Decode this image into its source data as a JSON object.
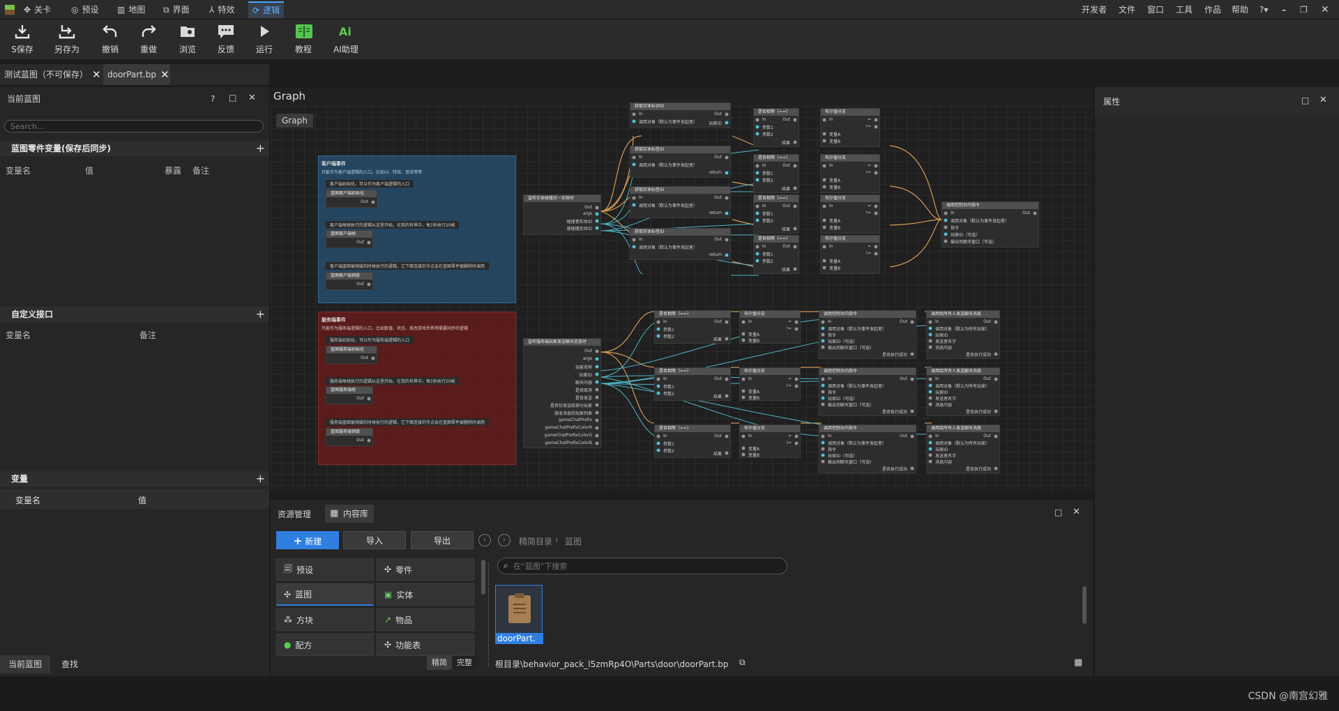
{
  "menubar": {
    "tabs": [
      {
        "label": "关卡",
        "icon": "compass-icon"
      },
      {
        "label": "预设",
        "icon": "target-icon"
      },
      {
        "label": "地图",
        "icon": "map-icon"
      },
      {
        "label": "界面",
        "icon": "ui-icon"
      },
      {
        "label": "特效",
        "icon": "effects-icon"
      },
      {
        "label": "逻辑",
        "icon": "logic-icon",
        "active": true
      }
    ],
    "right_menus": [
      "开发者",
      "文件",
      "窗口",
      "工具",
      "作品",
      "帮助"
    ],
    "help_icon": "?▾"
  },
  "toolbar": {
    "buttons": [
      {
        "label": "S保存",
        "icon": "save-icon"
      },
      {
        "label": "另存为",
        "icon": "save-as-icon"
      },
      {
        "label": "撤销",
        "icon": "undo-icon"
      },
      {
        "label": "重做",
        "icon": "redo-icon"
      },
      {
        "label": "浏览",
        "icon": "browse-icon"
      },
      {
        "label": "反馈",
        "icon": "feedback-icon"
      },
      {
        "label": "运行",
        "icon": "run-icon"
      },
      {
        "label": "教程",
        "icon": "tutorial-icon"
      },
      {
        "label": "AI助理",
        "icon": "ai-icon"
      }
    ]
  },
  "doc_tabs": [
    {
      "label": "测试蓝图（不可保存）"
    },
    {
      "label": "doorPart.bp",
      "active": true
    }
  ],
  "left_panel": {
    "title": "当前蓝图",
    "search_placeholder": "Search...",
    "section1": {
      "title": "蓝图零件变量(保存后同步)",
      "cols": [
        "变量名",
        "值",
        "暴露",
        "备注"
      ]
    },
    "section2": {
      "title": "自定义接口",
      "cols": [
        "变量名",
        "备注"
      ]
    },
    "section3": {
      "title": "变量",
      "cols": [
        "变量名",
        "值"
      ]
    },
    "bottom_tabs": [
      "当前蓝图",
      "查找"
    ]
  },
  "graph": {
    "title": "Graph",
    "breadcrumb": "Graph",
    "client_comment": {
      "title": "客户端事件",
      "subtitle": "只能作为客户端逻辑的入口，比如UI、特效、音效等等",
      "items": [
        {
          "desc": "客户端初始化，可以作为客户端逻辑的入口",
          "node": "蓝图客户端初始化",
          "pin": "Out"
        },
        {
          "desc": "客户端每帧执行的逻辑从这里开始，在我的世界中，每1秒执行20帧",
          "node": "蓝图客户端帧",
          "pin": "Out"
        },
        {
          "desc": "客户端蓝图被销毁的时候执行的逻辑，它下面连接的节点会在蓝图零件被删除时调用",
          "node": "蓝图客户端销毁",
          "pin": "Out"
        }
      ]
    },
    "server_comment": {
      "title": "服务端事件",
      "subtitle": "只能作为服务端逻辑的入口，比如数值、状态、修改游戏世界等需要同步的逻辑",
      "items": [
        {
          "desc": "服务端初始化，可以作为服务端逻辑的入口",
          "node": "蓝图服务端初始化",
          "pin": "Out"
        },
        {
          "desc": "服务端每帧执行的逻辑从这里开始，在我的世界中，每1秒执行20帧",
          "node": "蓝图服务端帧",
          "pin": "Out"
        },
        {
          "desc": "服务端蓝图被销毁的时候执行的逻辑，它下面连接的节点会在蓝图零件被删除时调用",
          "node": "蓝图服务端销毁",
          "pin": "Out"
        }
      ]
    },
    "client_event_node": {
      "title": "监听实体碰撞另一实体时",
      "pins": [
        "Out",
        "args",
        "碰撞者实体ID",
        "被碰撞实体ID"
      ]
    },
    "server_event_node": {
      "title": "监听服务端玩家发送聊天信息时",
      "pins": [
        "Out",
        "args",
        "玩家名称",
        "玩家ID",
        "聊天内容",
        "是否取消",
        "是否发送",
        "是否仅发送给部分玩家",
        "接收消息的玩家列表",
        "gameChatPrefix",
        "gameChatPrefixColorR",
        "gameChatPrefixColorG",
        "gameChatPrefixColorB"
      ]
    },
    "labels": {
      "get_id": "获取实体标识ID",
      "get_tag": "获取实体标签ID",
      "is_equal": "是否相等（==）",
      "branch": "布尔值分支",
      "send_cmd": "调用控制台内指令",
      "send_msg": "调用给所有人发送聊天消息",
      "in": "In",
      "out": "Out",
      "true_out": "=",
      "false_out": "!=",
      "target": "调用对象（默认为事件发起者）",
      "param1": "参数1",
      "param2": "参数2",
      "result": "结果",
      "var_a": "变量A",
      "var_b": "变量B",
      "return": "return",
      "player_id": "玩家ID",
      "cmd": "指令",
      "cmd_player": "玩家ID（可选）",
      "cmd_output": "输出到聊天窗口（可选）",
      "success": "是否执行成功",
      "msg_content": "消息内容",
      "send_name": "发送者名字",
      "msg_target": "调用对象（默认为所有玩家）"
    }
  },
  "resources": {
    "tabs": [
      "资源管理",
      "内容库"
    ],
    "new_btn": "新建",
    "import_btn": "导入",
    "export_btn": "导出",
    "breadcrumb": [
      "精简目录",
      "蓝图"
    ],
    "search_placeholder": "在“蓝图”下搜索",
    "categories": [
      {
        "label": "预设",
        "icon": "preset-icon"
      },
      {
        "label": "零件",
        "icon": "part-icon"
      },
      {
        "label": "蓝图",
        "icon": "blueprint-icon",
        "active": true
      },
      {
        "label": "实体",
        "icon": "entity-icon"
      },
      {
        "label": "方块",
        "icon": "block-icon"
      },
      {
        "label": "物品",
        "icon": "item-icon"
      },
      {
        "label": "配方",
        "icon": "recipe-icon"
      },
      {
        "label": "功能表",
        "icon": "table-icon"
      }
    ],
    "file": {
      "name": "doorPart.",
      "icon": "clipboard-icon"
    },
    "mode_tabs": [
      "精简",
      "完整"
    ],
    "path": "根目录\\behavior_pack_l5zmRp4O\\Parts\\door\\doorPart.bp"
  },
  "properties": {
    "title": "属性"
  },
  "watermark": "CSDN @南宫幻雅"
}
